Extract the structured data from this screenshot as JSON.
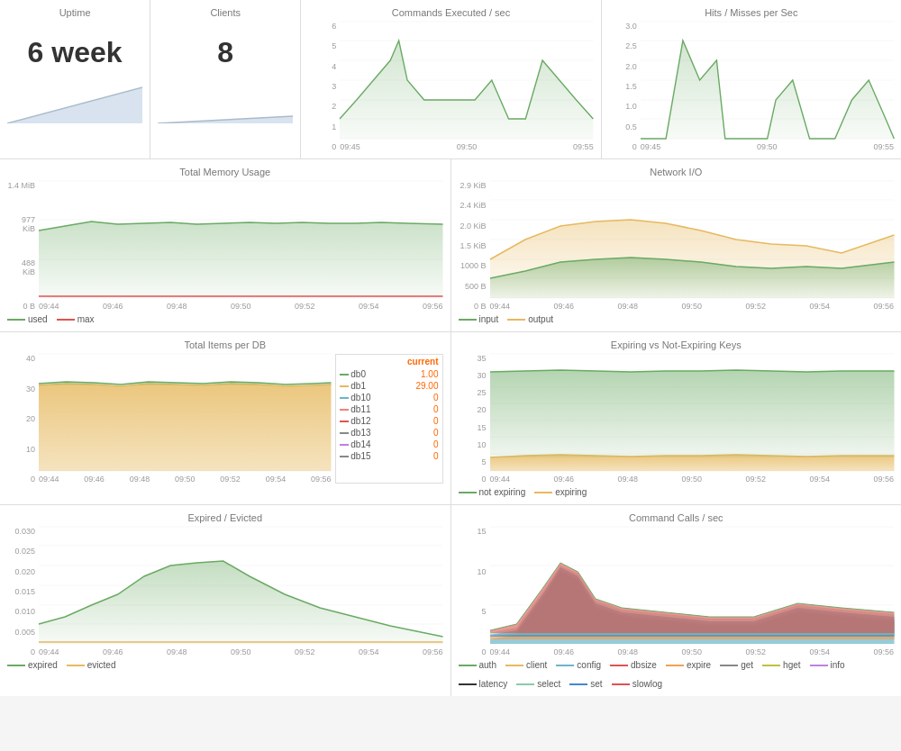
{
  "uptime": {
    "title": "Uptime",
    "value": "6 week"
  },
  "clients": {
    "title": "Clients",
    "value": "8"
  },
  "commands": {
    "title": "Commands Executed / sec",
    "xLabels": [
      "09:45",
      "09:50",
      "09:55"
    ],
    "yLabels": [
      "6",
      "5",
      "4",
      "3",
      "2",
      "1",
      "0"
    ]
  },
  "hits": {
    "title": "Hits / Misses per Sec",
    "xLabels": [
      "09:45",
      "09:50",
      "09:55"
    ],
    "yLabels": [
      "3.0",
      "2.5",
      "2.0",
      "1.5",
      "1.0",
      "0.5",
      "0"
    ]
  },
  "memory": {
    "title": "Total Memory Usage",
    "xLabels": [
      "09:44",
      "09:46",
      "09:48",
      "09:50",
      "09:52",
      "09:54",
      "09:56"
    ],
    "yLabels": [
      "1.4 MiB",
      "977 KiB",
      "488 KiB",
      "0 B"
    ],
    "legend": [
      {
        "label": "used",
        "color": "#6aaa64"
      },
      {
        "label": "max",
        "color": "#e05252"
      }
    ]
  },
  "network": {
    "title": "Network I/O",
    "xLabels": [
      "09:44",
      "09:46",
      "09:48",
      "09:50",
      "09:52",
      "09:54",
      "09:56"
    ],
    "yLabels": [
      "2.9 KiB",
      "2.4 KiB",
      "2.0 KiB",
      "1.5 KiB",
      "1000 B",
      "500 B",
      "0 B"
    ],
    "legend": [
      {
        "label": "input",
        "color": "#6aaa64"
      },
      {
        "label": "output",
        "color": "#e6b95e"
      }
    ]
  },
  "itemsPerDB": {
    "title": "Total Items per DB",
    "xLabels": [
      "09:44",
      "09:46",
      "09:48",
      "09:50",
      "09:52",
      "09:54",
      "09:56"
    ],
    "yLabels": [
      "40",
      "30",
      "20",
      "10",
      "0"
    ],
    "currentLabel": "current",
    "dbs": [
      {
        "name": "db0",
        "color": "#6aaa64",
        "value": "1.00"
      },
      {
        "name": "db1",
        "color": "#e6b95e",
        "value": "29.00"
      },
      {
        "name": "db10",
        "color": "#6bb5c8",
        "value": "0"
      },
      {
        "name": "db11",
        "color": "#f08080",
        "value": "0"
      },
      {
        "name": "db12",
        "color": "#e05252",
        "value": "0"
      },
      {
        "name": "db13",
        "color": "#888",
        "value": "0"
      },
      {
        "name": "db14",
        "color": "#c080e0",
        "value": "0"
      },
      {
        "name": "db15",
        "color": "#888",
        "value": "0"
      }
    ]
  },
  "expiring": {
    "title": "Expiring vs Not-Expiring Keys",
    "xLabels": [
      "09:44",
      "09:46",
      "09:48",
      "09:50",
      "09:52",
      "09:54",
      "09:56"
    ],
    "yLabels": [
      "35",
      "30",
      "25",
      "20",
      "15",
      "10",
      "5",
      "0"
    ],
    "legend": [
      {
        "label": "not expiring",
        "color": "#6aaa64"
      },
      {
        "label": "expiring",
        "color": "#e6b95e"
      }
    ]
  },
  "expired": {
    "title": "Expired / Evicted",
    "xLabels": [
      "09:44",
      "09:46",
      "09:48",
      "09:50",
      "09:52",
      "09:54",
      "09:56"
    ],
    "yLabels": [
      "0.030",
      "0.025",
      "0.020",
      "0.015",
      "0.010",
      "0.005",
      "0"
    ],
    "legend": [
      {
        "label": "expired",
        "color": "#6aaa64"
      },
      {
        "label": "evicted",
        "color": "#e6b95e"
      }
    ]
  },
  "commandCalls": {
    "title": "Command Calls / sec",
    "xLabels": [
      "09:44",
      "09:46",
      "09:48",
      "09:50",
      "09:52",
      "09:54",
      "09:56"
    ],
    "yLabels": [
      "15",
      "10",
      "5",
      "0"
    ],
    "legend": [
      {
        "label": "auth",
        "color": "#6aaa64"
      },
      {
        "label": "client",
        "color": "#e6b95e"
      },
      {
        "label": "config",
        "color": "#6bb5c8"
      },
      {
        "label": "dbsize",
        "color": "#e05252"
      },
      {
        "label": "expire",
        "color": "#f0a050"
      },
      {
        "label": "get",
        "color": "#888"
      },
      {
        "label": "hget",
        "color": "#c0c040"
      },
      {
        "label": "info",
        "color": "#c080e0"
      },
      {
        "label": "latency",
        "color": "#333"
      },
      {
        "label": "select",
        "color": "#88ccaa"
      },
      {
        "label": "set",
        "color": "#4488cc"
      },
      {
        "label": "slowlog",
        "color": "#e05252"
      }
    ]
  }
}
